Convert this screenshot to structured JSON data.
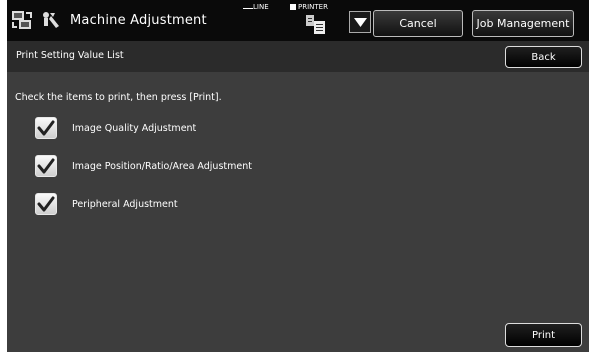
{
  "header": {
    "title": "Machine Adjustment",
    "line_label": "LINE",
    "printer_label": "PRINTER",
    "cancel_label": "Cancel",
    "job_management_label": "Job Management"
  },
  "subheader": {
    "title": "Print Setting Value List",
    "back_label": "Back"
  },
  "content": {
    "instruction": "Check the items to print, then press [Print].",
    "items": [
      {
        "label": "Image Quality Adjustment",
        "checked": true
      },
      {
        "label": "Image Position/Ratio/Area Adjustment",
        "checked": true
      },
      {
        "label": "Peripheral Adjustment",
        "checked": true
      }
    ],
    "print_label": "Print"
  },
  "icons": {
    "mode": "mode-switch-icon",
    "tool": "adjustment-tool-icon",
    "printer": "printer-job-icon",
    "dropdown": "dropdown-arrow-icon",
    "check": "checkmark-icon"
  }
}
